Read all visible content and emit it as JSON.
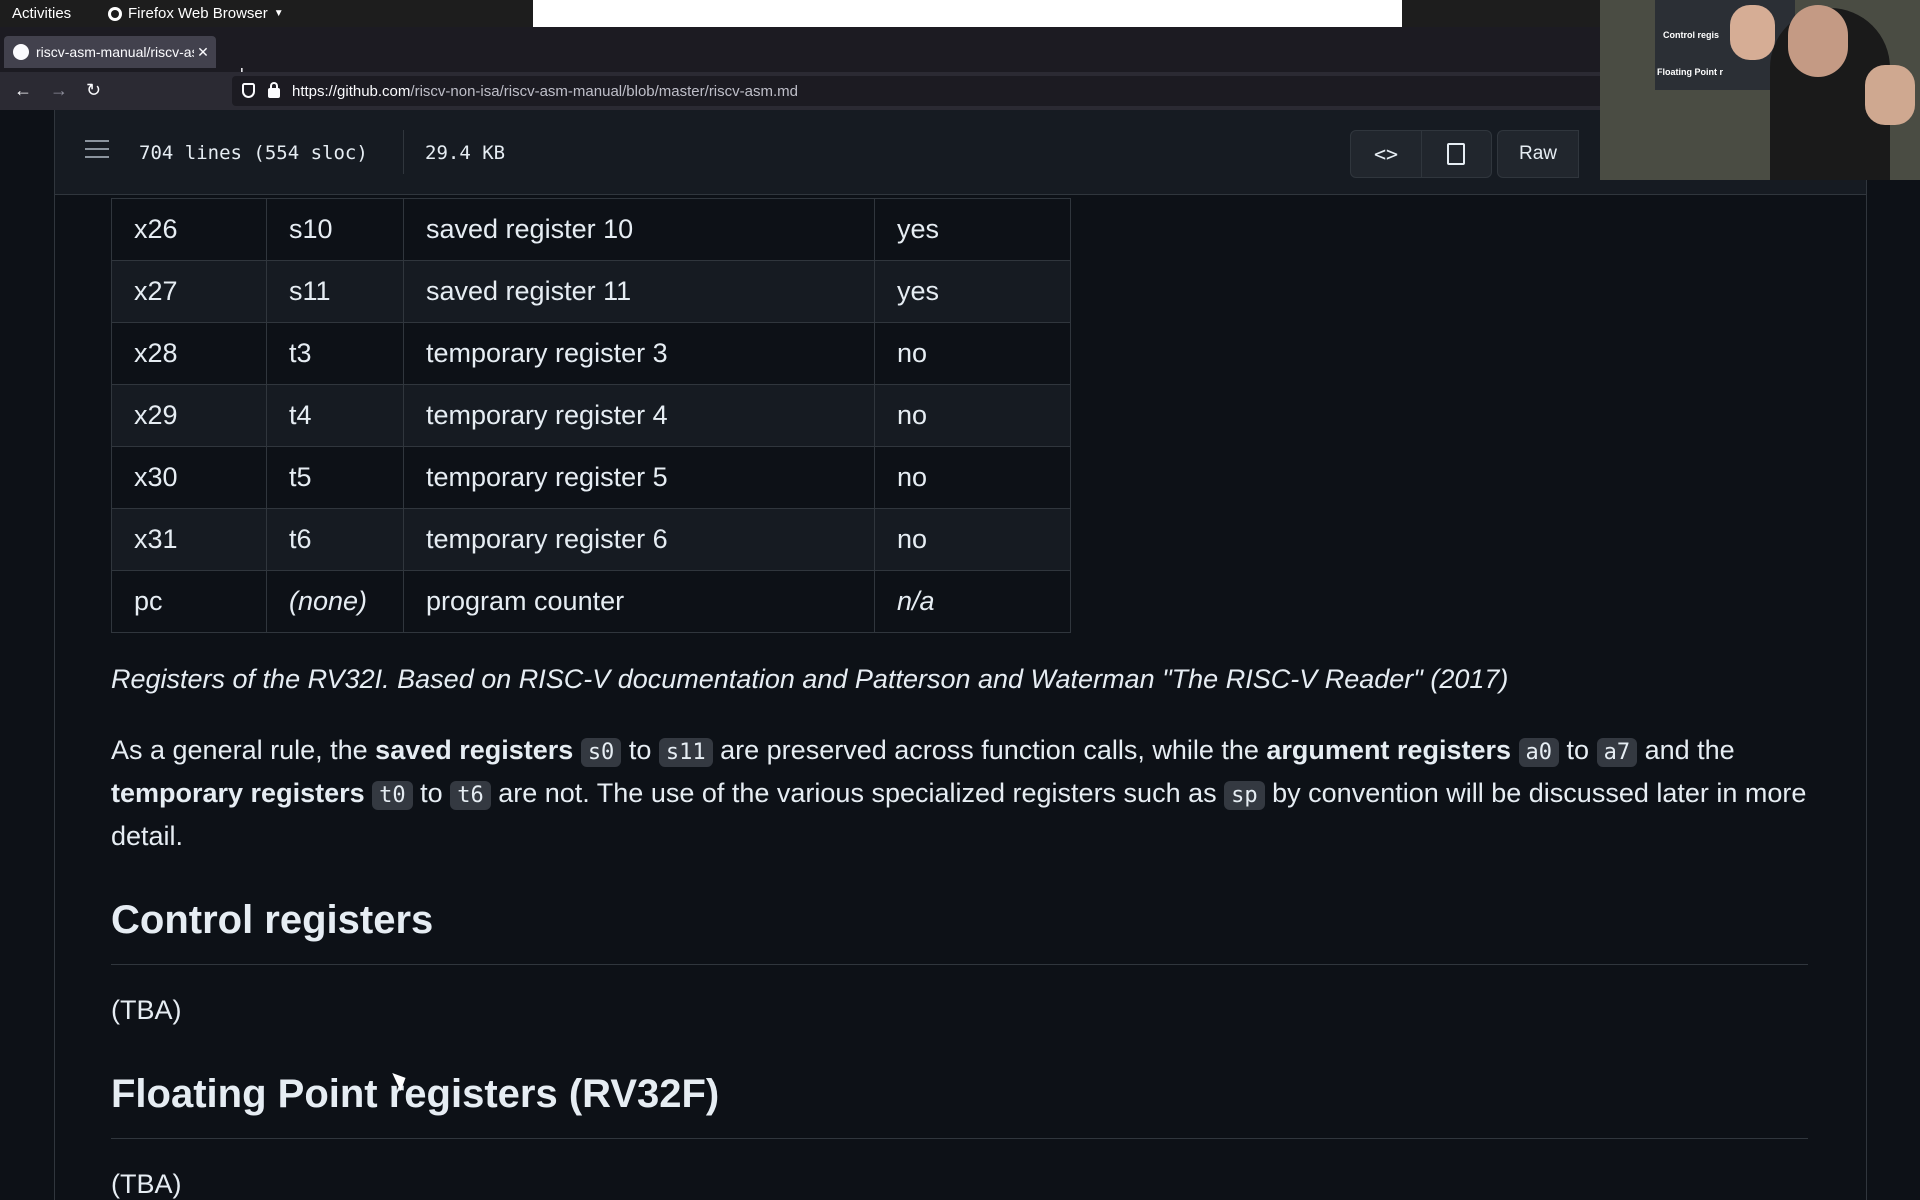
{
  "desktop": {
    "activities": "Activities",
    "app_name": "Firefox Web Browser"
  },
  "browser": {
    "tab_title": "riscv-asm-manual/riscv-as",
    "new_tab": "+",
    "url_host": "https://github.com",
    "url_path": "/riscv-non-isa/riscv-asm-manual/blob/master/riscv-asm.md"
  },
  "file_header": {
    "lines": "704 lines (554 sloc)",
    "size": "29.4 KB",
    "code_view": "<>",
    "raw": "Raw"
  },
  "register_table": [
    [
      "x26",
      "s10",
      "saved register 10",
      "yes"
    ],
    [
      "x27",
      "s11",
      "saved register 11",
      "yes"
    ],
    [
      "x28",
      "t3",
      "temporary register 3",
      "no"
    ],
    [
      "x29",
      "t4",
      "temporary register 4",
      "no"
    ],
    [
      "x30",
      "t5",
      "temporary register 5",
      "no"
    ],
    [
      "x31",
      "t6",
      "temporary register 6",
      "no"
    ],
    [
      "pc",
      "(none)",
      "program counter",
      "n/a"
    ]
  ],
  "caption": "Registers of the RV32I. Based on RISC-V documentation and Patterson and Waterman \"The RISC-V Reader\" (2017)",
  "paragraph": {
    "t1": "As a general rule, the ",
    "b1": "saved registers",
    "c1": "s0",
    "to": "to",
    "c2": "s11",
    "t2": "are preserved across function calls, while the ",
    "b2": "argument registers",
    "c3": "a0",
    "c4": "a7",
    "t3": "and the",
    "b3": "temporary registers",
    "c5": "t0",
    "c6": "t6",
    "t4": "are not. The use of the various specialized registers such as",
    "c7": "sp",
    "t5": "by convention will be discussed later in more detail."
  },
  "sections": [
    {
      "heading": "Control registers",
      "body": "(TBA)"
    },
    {
      "heading": "Floating Point registers (RV32F)",
      "body": "(TBA)"
    }
  ],
  "webcam": {
    "text1": "Control regis",
    "text2": "Floating Point r"
  }
}
